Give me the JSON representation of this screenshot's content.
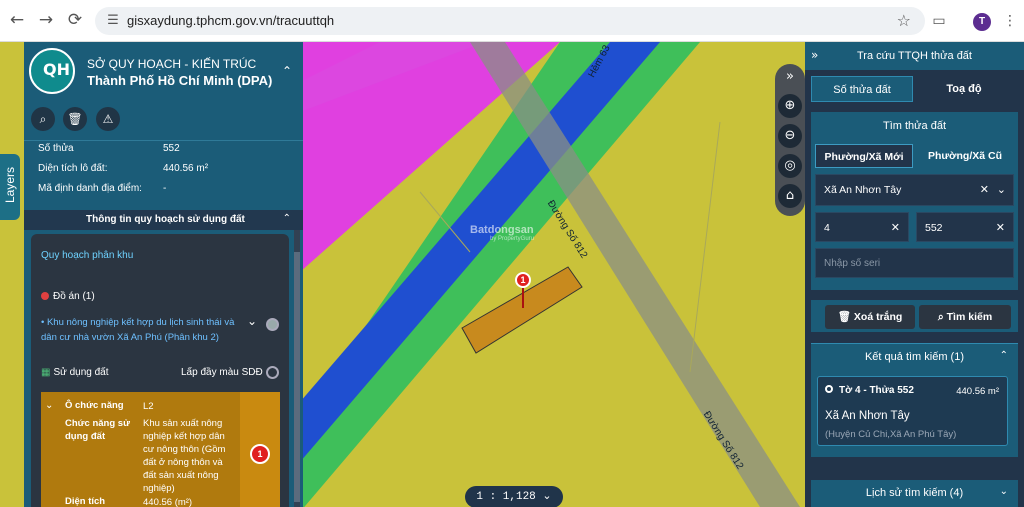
{
  "browser": {
    "url": "gisxaydung.tphcm.gov.vn/tracuuttqh",
    "avatar_letter": "T",
    "icons": [
      "back-arrow-icon",
      "forward-arrow-icon",
      "reload-icon",
      "site-settings-icon",
      "bookmark-star-icon",
      "cast-icon",
      "more-icon"
    ]
  },
  "left_panel": {
    "title_line1": "SỞ QUY HOẠCH - KIẾN TRÚC",
    "title_line2": "Thành Phố Hồ Chí Minh (DPA)",
    "info": [
      {
        "label": "Số thửa",
        "value": "552"
      },
      {
        "label": "Diện tích lô đất:",
        "value": "440.56 m²"
      },
      {
        "label": "Mã định danh địa điểm:",
        "value": "-"
      }
    ],
    "section_title": "Thông tin quy hoạch sử dụng đất",
    "card": {
      "heading": "Quy hoạch phân khu",
      "do_an": "Đồ án (1)",
      "plan_link": "• Khu nông nghiệp kết hợp du lịch sinh thái và dân cư nhà vườn Xã An Phú (Phân khu 2)",
      "su_dung_dat": "Sử dụng đất",
      "fill_color_label": "Lấp đầy màu SDĐ",
      "zone": {
        "o_chuc_nang_label": "Ô chức năng",
        "o_chuc_nang_value": "L2",
        "chuc_nang_label": "Chức năng sử dụng đất",
        "chuc_nang_value": "Khu sản xuất nông nghiệp kết hợp dân cư nông thôn (Gồm đất ở nông thôn và đất sản xuất nông nghiệp)",
        "dien_tich_label": "Diện tích",
        "dien_tich_value": "440.56 (m²)",
        "badge": "1",
        "color": "#b07a0e"
      }
    }
  },
  "layers_tab": "Layers",
  "map": {
    "watermark": "Batdongsan",
    "watermark_sub": "by PropertyGuru",
    "road_label_1": "Đường Số 812",
    "road_label_2": "Đường Số 812",
    "road_label_3": "Hẻm 63",
    "marker_number": "1",
    "scale": "1 : 1,128",
    "colors": {
      "agri": "#c9c23a",
      "magenta": "#e040e0",
      "green": "#3fbf5a",
      "river": "#1f4fd0",
      "parcel": "#c88a1e"
    }
  },
  "right_panel": {
    "header": "Tra cứu TTQH thửa đất",
    "tabs": [
      "Số thửa đất",
      "Toạ độ"
    ],
    "finder_title": "Tìm thửa đất",
    "subtabs": [
      "Phường/Xã Mới",
      "Phường/Xã Cũ"
    ],
    "ward": "Xã An Nhơn Tây",
    "to": "4",
    "thua": "552",
    "seri_placeholder": "Nhập số seri",
    "clear_button": "Xoá trắng",
    "search_button": "Tìm kiếm",
    "results_header": "Kết quả tìm kiếm (1)",
    "result": {
      "title": "Tờ 4 - Thửa 552",
      "area": "440.56 m²",
      "ward": "Xã An Nhơn Tây",
      "old": "(Huyện Củ Chi,Xã An Phú Tây)"
    },
    "history": "Lịch sử tìm kiếm (4)"
  }
}
